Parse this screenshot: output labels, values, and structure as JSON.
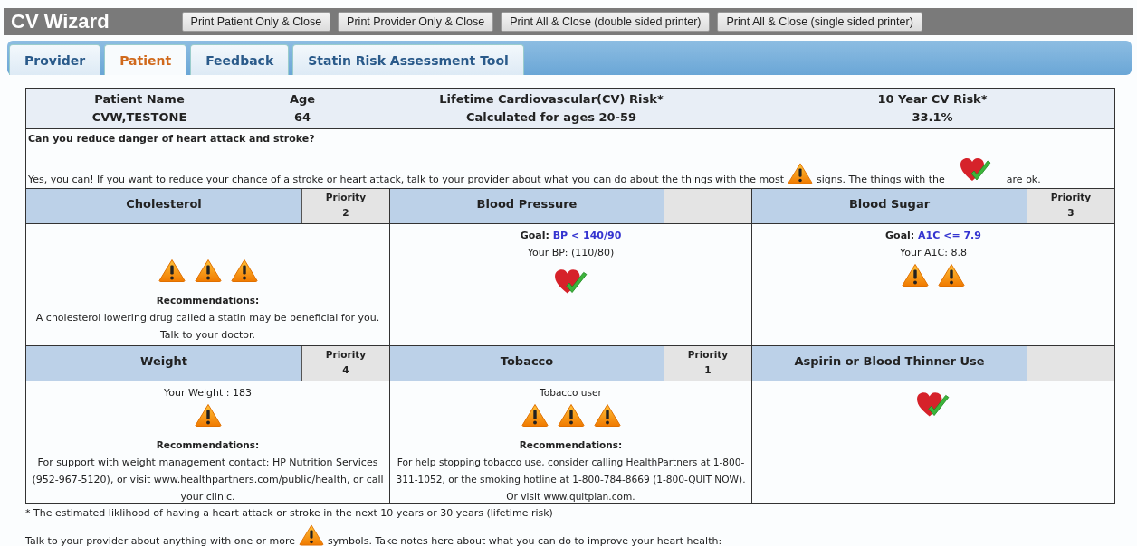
{
  "app": {
    "title": "CV Wizard"
  },
  "print_buttons": [
    "Print Patient Only & Close",
    "Print Provider Only & Close",
    "Print All & Close (double sided printer)",
    "Print All & Close (single sided printer)"
  ],
  "tabs": [
    {
      "label": "Provider",
      "selected": false
    },
    {
      "label": "Patient",
      "selected": true
    },
    {
      "label": "Feedback",
      "selected": false
    },
    {
      "label": "Statin Risk Assessment Tool",
      "selected": false
    }
  ],
  "summary": [
    {
      "heading": "Patient Name",
      "value": "CVW,TESTONE"
    },
    {
      "heading": "Age",
      "value": "64"
    },
    {
      "heading": "Lifetime Cardiovascular(CV) Risk*",
      "value": "Calculated for ages 20-59"
    },
    {
      "heading": "10 Year CV Risk*",
      "value": "33.1%"
    }
  ],
  "question": "Can you reduce danger of heart attack and stroke?",
  "intro": [
    {
      "kind": "text",
      "text": "Yes, you can! If you want to reduce your chance of a stroke or heart attack, talk to your provider about what you can do about the things with the most"
    },
    {
      "kind": "warning"
    },
    {
      "kind": "text",
      "text": "signs. The things with the"
    },
    {
      "kind": "ok"
    },
    {
      "kind": "text",
      "text": "are ok."
    }
  ],
  "cards": [
    {
      "title": "Cholesterol",
      "priority_label": "Priority",
      "priority": "2",
      "items": [
        {
          "kind": "icons",
          "icons": [
            {
              "kind": "warning"
            },
            {
              "kind": "warning"
            },
            {
              "kind": "warning"
            }
          ]
        },
        {
          "kind": "heading",
          "text": "Recommendations:"
        },
        {
          "kind": "text",
          "text": "A cholesterol lowering drug called a statin may be beneficial for you. Talk to your doctor."
        }
      ]
    },
    {
      "title": "Blood Pressure",
      "items": [
        {
          "kind": "goal",
          "label": "Goal:",
          "value": "BP < 140/90"
        },
        {
          "kind": "text",
          "text": "Your BP: (110/80)"
        },
        {
          "kind": "ok"
        }
      ]
    },
    {
      "title": "Blood Sugar",
      "priority_label": "Priority",
      "priority": "3",
      "items": [
        {
          "kind": "goal",
          "label": "Goal:",
          "value": "A1C <= 7.9"
        },
        {
          "kind": "text",
          "text": "Your A1C: 8.8"
        },
        {
          "kind": "icons",
          "icons": [
            {
              "kind": "warning"
            },
            {
              "kind": "warning"
            }
          ]
        }
      ]
    },
    {
      "title": "Weight",
      "priority_label": "Priority",
      "priority": "4",
      "items": [
        {
          "kind": "text",
          "text": "Your Weight : 183"
        },
        {
          "kind": "icons",
          "icons": [
            {
              "kind": "warning"
            }
          ]
        },
        {
          "kind": "heading",
          "text": "Recommendations:"
        },
        {
          "kind": "text",
          "text": "For support with weight management contact: HP Nutrition Services (952-967-5120), or visit www.healthpartners.com/public/health, or call your clinic."
        }
      ]
    },
    {
      "title": "Tobacco",
      "priority_label": "Priority",
      "priority": "1",
      "items": [
        {
          "kind": "text",
          "text": "Tobacco user"
        },
        {
          "kind": "icons",
          "icons": [
            {
              "kind": "warning"
            },
            {
              "kind": "warning"
            },
            {
              "kind": "warning"
            }
          ]
        },
        {
          "kind": "heading",
          "text": "Recommendations:"
        },
        {
          "kind": "text",
          "text": "For help stopping tobacco use, consider calling HealthPartners at 1-800-311-1052, or the smoking hotline at 1-800-784-8669 (1-800-QUIT NOW). Or visit www.quitplan.com."
        }
      ]
    },
    {
      "title": "Aspirin or Blood Thinner Use",
      "items": [
        {
          "kind": "ok"
        }
      ]
    }
  ],
  "footnote": "* The estimated liklihood of having a heart attack or stroke in the next 10 years or 30 years (lifetime risk)",
  "notes": [
    {
      "kind": "text",
      "text": "Talk to your provider about anything with one or more"
    },
    {
      "kind": "warning"
    },
    {
      "kind": "text",
      "text": "symbols. Take notes here about what you can do to improve your heart health:"
    }
  ]
}
